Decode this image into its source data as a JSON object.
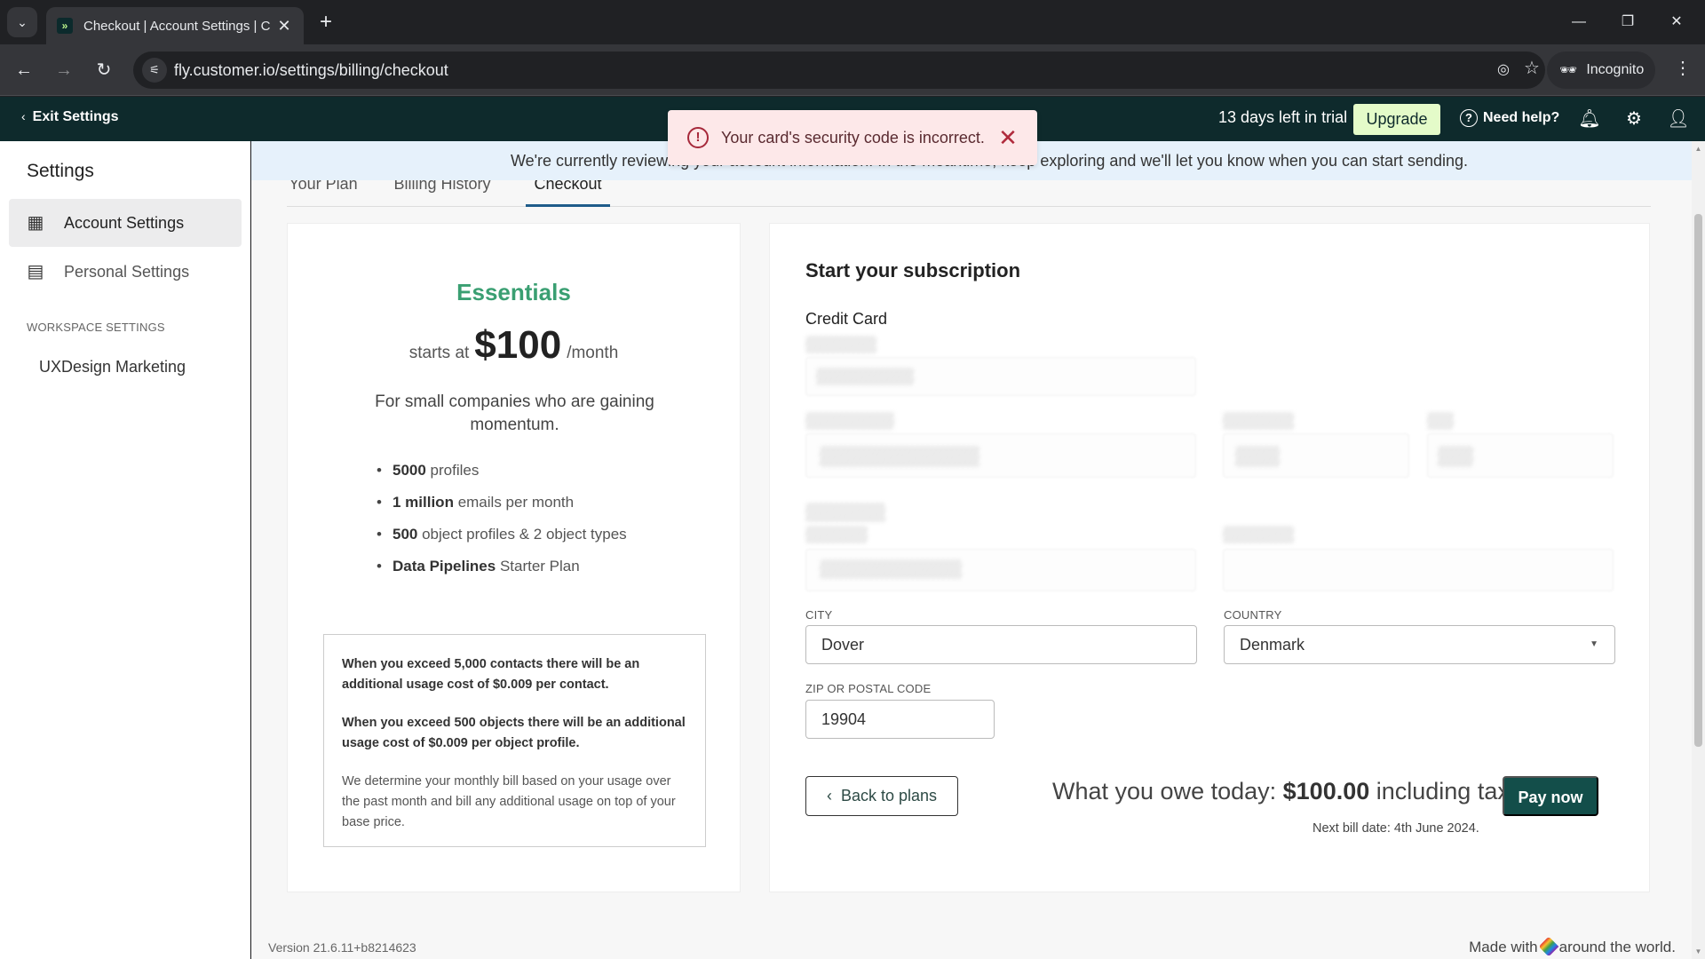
{
  "browser": {
    "tab_title": "Checkout | Account Settings | C",
    "url": "fly.customer.io/settings/billing/checkout",
    "incognito_label": "Incognito"
  },
  "header": {
    "exit_label": "Exit Settings",
    "trial_text": "13 days left in trial",
    "upgrade_label": "Upgrade",
    "help_label": "Need help?"
  },
  "toast": {
    "message": "Your card's security code is incorrect.",
    "accent": "#a6283a"
  },
  "sidebar": {
    "title": "Settings",
    "items": [
      {
        "label": "Account Settings",
        "icon": "building-icon",
        "active": true
      },
      {
        "label": "Personal Settings",
        "icon": "personal-settings-icon",
        "active": false
      }
    ],
    "workspace_label": "WORKSPACE SETTINGS",
    "workspace_item": "UXDesign Marketing"
  },
  "banner": {
    "text": "We're currently reviewing your account information. In the meantime, keep exploring and we'll let you know when you can start sending."
  },
  "tabs": [
    {
      "label": "Your Plan"
    },
    {
      "label": "Billing History"
    },
    {
      "label": "Checkout",
      "active": true
    }
  ],
  "plan": {
    "name": "Essentials",
    "starts_at": "starts at",
    "price": "$100",
    "per": "/month",
    "description": "For small companies who are gaining momentum.",
    "features": [
      {
        "bold": "5000",
        "rest": " profiles"
      },
      {
        "bold": "1 million",
        "rest": " emails per month"
      },
      {
        "bold": "500",
        "rest": " object profiles & 2 object types"
      },
      {
        "bold": "Data Pipelines",
        "rest": " Starter Plan"
      }
    ],
    "usage_notes": [
      "When you exceed 5,000 contacts there will be an additional usage cost of $0.009 per contact.",
      "When you exceed 500 objects there will be an additional usage cost of $0.009 per object profile.",
      "We determine your monthly bill based on your usage over the past month and bill any additional usage on top of your base price."
    ],
    "accent": "#3a9f72"
  },
  "subscription": {
    "title": "Start your subscription",
    "credit_card_label": "Credit Card",
    "city_label": "CITY",
    "city_value": "Dover",
    "country_label": "COUNTRY",
    "country_value": "Denmark",
    "zip_label": "ZIP OR POSTAL CODE",
    "zip_value": "19904",
    "back_label": "Back to plans",
    "owe_prefix": "What you owe today: ",
    "owe_amount": "$100.00",
    "owe_suffix": " including tax.",
    "pay_label": "Pay now",
    "next_bill": "Next bill date: 4th June 2024.",
    "pay_color": "#134e4a"
  },
  "footer": {
    "version": "Version 21.6.11+b8214623",
    "made_with_prefix": "Made with",
    "made_with_suffix": "around the world."
  }
}
